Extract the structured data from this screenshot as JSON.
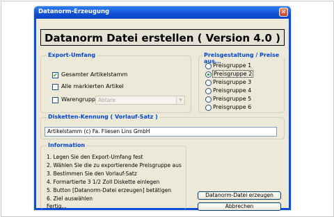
{
  "window": {
    "title": "Datanorm-Erzeugung"
  },
  "banner": {
    "text": "Datanorm Datei erstellen ( Version 4.0 )"
  },
  "export": {
    "legend": "Export-Umfang",
    "options": [
      {
        "label": "Gesamter Artikelstamm",
        "checked": true
      },
      {
        "label": "Alle markierten Artikel",
        "checked": false
      },
      {
        "label": "Warengruppe",
        "checked": false
      }
    ],
    "warengruppe_value": "Abtare"
  },
  "pricing": {
    "legend": "Preisgestaltung / Preise aus...",
    "options": [
      {
        "label": "Preisgruppe 1",
        "selected": false
      },
      {
        "label": "Preisgruppe 2",
        "selected": true
      },
      {
        "label": "Preisgruppe 3",
        "selected": false
      },
      {
        "label": "Preisgruppe 4",
        "selected": false
      },
      {
        "label": "Preisgruppe 5",
        "selected": false
      },
      {
        "label": "Preisgruppe 6",
        "selected": false
      }
    ]
  },
  "kennung": {
    "legend": "Disketten-Kennung ( Vorlauf-Satz )",
    "value": "Artikelstamm (c) Fa. Fliesen Lins GmbH"
  },
  "info": {
    "legend": "Information",
    "lines": [
      "1. Legen Sie den Export-Umfang fest",
      "2. Wählen Sie die zu exportierende Preisgruppe aus",
      "3. Bestimmen Sie den Vorlauf-Satz",
      "4. Formartierte 3 1/2 Zoll Diskette einlegen",
      "5. Button [Datanorm-Datei erzeugen] betätigen",
      "6. Ziel auswählen",
      "Fertig..."
    ]
  },
  "buttons": {
    "create": "Datanorm-Datei erzeugen",
    "cancel": "Abbrechen"
  },
  "colors": {
    "legend": "#0046d5",
    "face": "#ece9d8",
    "titlebar": "#0a4fd8",
    "check": "#21a121"
  }
}
